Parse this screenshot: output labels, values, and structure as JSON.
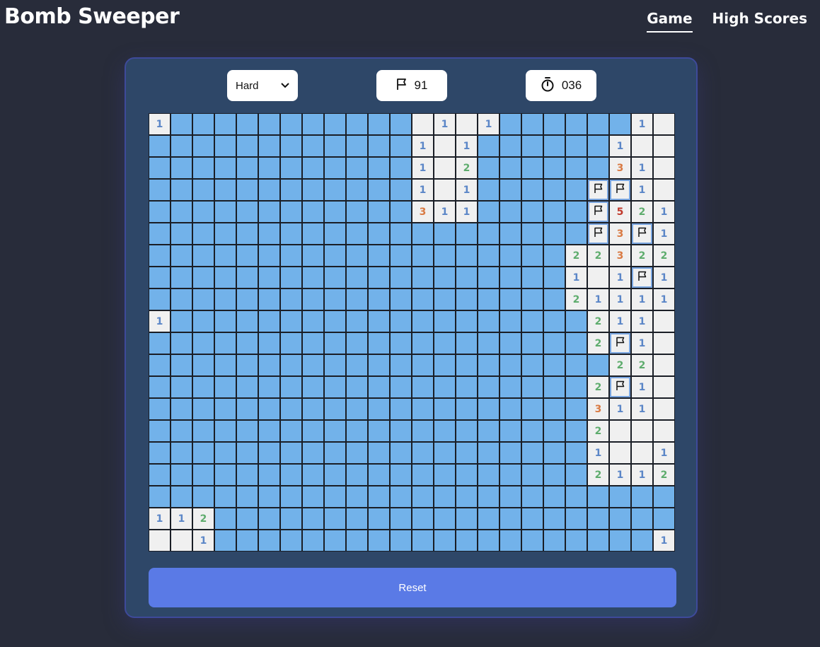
{
  "app": {
    "title": "Bomb Sweeper"
  },
  "nav": {
    "game": "Game",
    "high_scores": "High Scores"
  },
  "controls": {
    "difficulty": "Hard",
    "flags_remaining": "91",
    "timer": "036"
  },
  "actions": {
    "reset": "Reset"
  },
  "icons": {
    "flag": "flag-icon",
    "timer": "stopwatch-icon",
    "dropdown": "chevron-down-icon"
  },
  "colors": {
    "hidden_cell": "#72b2ea",
    "open_cell": "#f0f0f0",
    "num1": "#5b86c7",
    "num2": "#5eac6d",
    "num3": "#d97a43",
    "num5": "#c0392b",
    "reset_button": "#5a7ae6"
  },
  "board": {
    "rows": 20,
    "cols": 24,
    "legend": {
      "#": "hidden",
      ".": "empty",
      "F": "flagged",
      "1-8": "number"
    },
    "grid": [
      "1###########.1.1######1...",
      "############1.1######1...",
      "############1.2######31..",
      "############1.1#####FF1..",
      "############311#####F521.",
      "####################F3F1.",
      "###################22322.",
      "###################1.1F1.",
      "###################21111.",
      "1###################211..",
      "####################2F1..",
      "#####################22..",
      "####################2F1..",
      "####################311..",
      "####################2....",
      "####################1..11",
      "####################2112#",
      "########################",
      "112#####################",
      "..1####################1"
    ]
  }
}
